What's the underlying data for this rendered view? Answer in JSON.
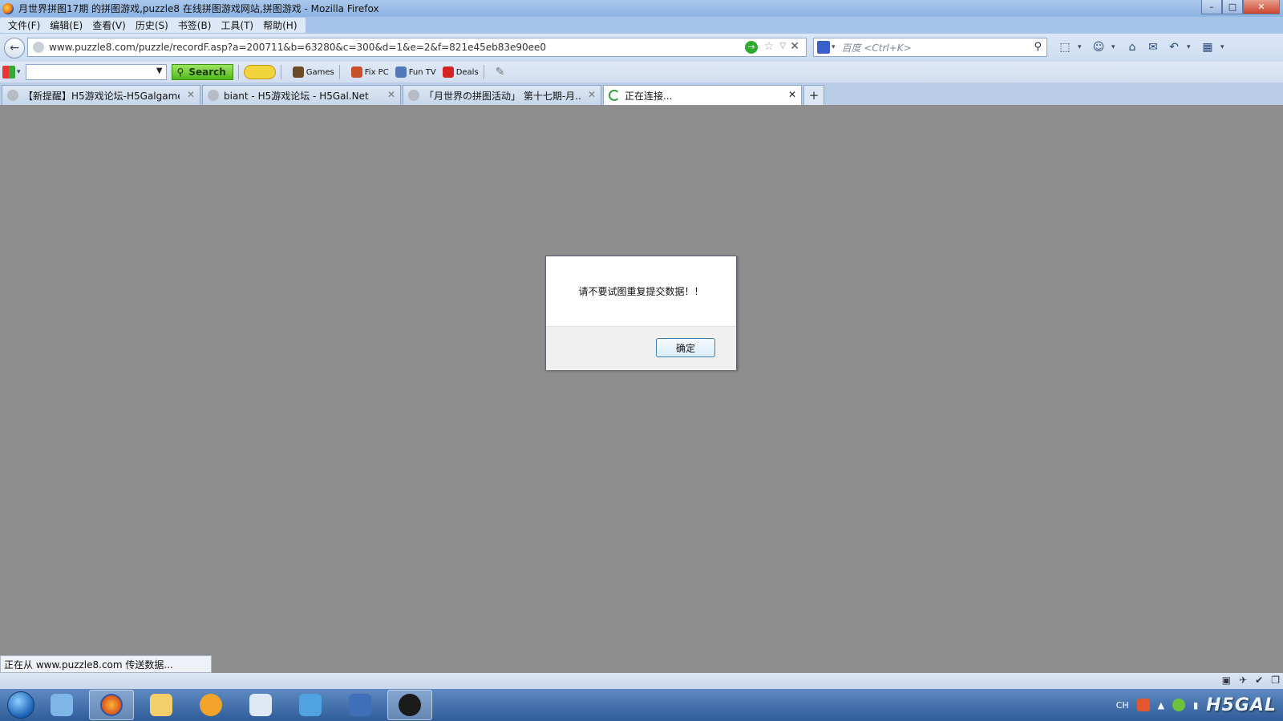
{
  "window": {
    "title": "月世界拼图17期 的拼图游戏,puzzle8 在线拼图游戏网站,拼图游戏 - Mozilla Firefox",
    "controls": {
      "minimize": "–",
      "maximize": "□",
      "close": "✕"
    }
  },
  "menubar": {
    "items": [
      {
        "label": "文件(F)"
      },
      {
        "label": "编辑(E)"
      },
      {
        "label": "查看(V)"
      },
      {
        "label": "历史(S)"
      },
      {
        "label": "书签(B)"
      },
      {
        "label": "工具(T)"
      },
      {
        "label": "帮助(H)"
      }
    ]
  },
  "navbar": {
    "url": "www.puzzle8.com/puzzle/recordF.asp?a=200711&b=63280&c=300&d=1&e=2&f=821e45eb83e90ee0",
    "search_placeholder": "百度 <Ctrl+K>",
    "icons": [
      "go-icon",
      "bookmark-star-icon",
      "stop-icon",
      "screenshot-icon",
      "smiley-icon",
      "home-icon",
      "mail-icon",
      "undo-icon",
      "windows-flag-icon"
    ]
  },
  "addonbar": {
    "search_label": "Search",
    "buttons": [
      {
        "label": "Games"
      },
      {
        "label": "Fix PC"
      },
      {
        "label": "Fun TV"
      },
      {
        "label": "Deals"
      }
    ]
  },
  "tabs": [
    {
      "label": "【新提醒】H5游戏论坛-H5Galgame...",
      "active": false
    },
    {
      "label": "biant - H5游戏论坛 - H5Gal.Net",
      "active": false
    },
    {
      "label": "「月世界の拼图活动」 第十七期-月...",
      "active": false
    },
    {
      "label": "正在连接...",
      "active": true
    }
  ],
  "dialog": {
    "message": "请不要试图重复提交数据！！",
    "ok_label": "确定"
  },
  "status": {
    "text": "正在从 www.puzzle8.com 传送数据..."
  },
  "taskbar": {
    "tray_lang": "CH",
    "logo_text": "H5GAL",
    "apps": [
      "start-button",
      "network-icon",
      "firefox-icon",
      "folder-icon",
      "headset-icon",
      "app-s-icon",
      "bird-app-icon",
      "film-icon",
      "qq-icon"
    ]
  },
  "colors": {
    "content_bg": "#8e8e8e",
    "titlebar": "#a9c7ec",
    "search_green": "#52b81f",
    "dialog_button_border": "#3c7fb1"
  }
}
